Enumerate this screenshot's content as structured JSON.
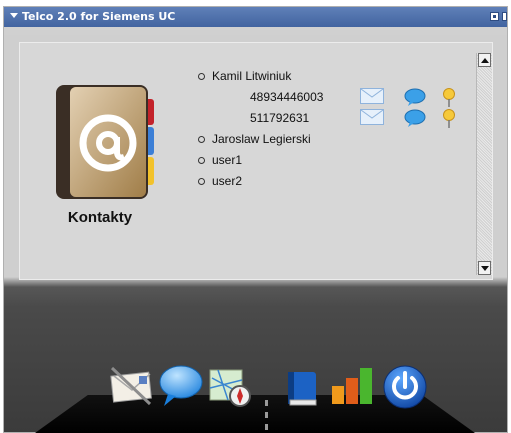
{
  "widget": {
    "title": "Telco 2.0 for Siemens UC",
    "controls": [
      "edit-icon",
      "close-icon"
    ]
  },
  "contacts": {
    "label": "Kontakty",
    "icon": "address-book-icon",
    "colors": {
      "cover": "#c7a166",
      "spine": "#3a2e25",
      "tab_red": "#c3222a",
      "tab_blue": "#3c7fd6",
      "tab_yellow": "#f2c22b"
    },
    "list": [
      {
        "name": "Kamil Litwiniuk",
        "phones": [
          "48934446003",
          "511792631"
        ]
      },
      {
        "name": "Jaroslaw Legierski",
        "phones": []
      },
      {
        "name": "user1",
        "phones": []
      },
      {
        "name": "user2",
        "phones": []
      }
    ],
    "phone_actions": [
      "email-icon",
      "chat-bubble-icon",
      "location-pin-icon"
    ]
  },
  "dock": {
    "items": [
      "mail-icon",
      "chat-icon",
      "map-compass-icon",
      "book-icon",
      "chart-icon",
      "power-icon"
    ]
  }
}
